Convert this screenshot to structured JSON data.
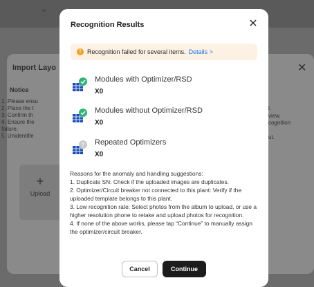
{
  "background": {
    "dialog_title": "Import Layo",
    "notice_title": "Notice",
    "notice_lines": [
      "1. Please ensu",
      "2. Place the t",
      "3. Confirm th",
      "4. Ensure the",
      "failure.",
      "5. Unidentifie"
    ],
    "right_lines": [
      "l.",
      "view.",
      "cognition",
      "",
      "ut."
    ],
    "upload_label": "Upload"
  },
  "modal": {
    "title": "Recognition Results",
    "alert": {
      "text": "Recognition failed for several items.",
      "link": "Details >"
    },
    "results": [
      {
        "label": "Modules with Optimizer/RSD",
        "count": "X0",
        "icon": "module-check-icon"
      },
      {
        "label": "Modules without Optimizer/RSD",
        "count": "X0",
        "icon": "module-check-icon"
      },
      {
        "label": "Repeated Optimizers",
        "count": "X0",
        "icon": "module-question-icon"
      }
    ],
    "reasons": [
      "Reasons for the anomaly and handling suggestions:",
      "1. Duplicate SN: Check if the uploaded images are duplicates.",
      "2. Optimizer/Circuit breaker not connected to this plant: Verify if the uploaded template belongs to this plant.",
      "3. Low recognition rate: Select photos from the album to upload, or use a higher resolution phone to retake and upload photos for recognition.",
      "4. If none of the above works, please tap “Continue” to manually assign the optimizer/circuit breaker."
    ],
    "cancel_label": "Cancel",
    "continue_label": "Continue"
  },
  "colors": {
    "accent_link": "#1a73e8",
    "warning": "#f0a020",
    "success": "#2bb673",
    "module_blue": "#1d4fb8"
  }
}
